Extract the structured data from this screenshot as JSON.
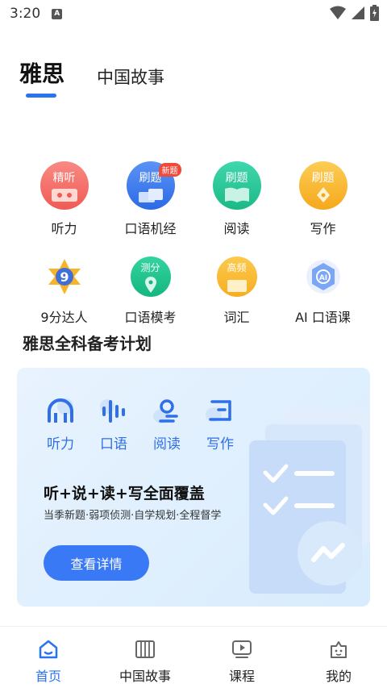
{
  "status": {
    "time": "3:20",
    "notification_letter": "A"
  },
  "top_tabs": [
    {
      "label": "雅思"
    },
    {
      "label": "中国故事"
    }
  ],
  "grid": [
    {
      "label": "听力",
      "icon_text": "精听",
      "icon": "listening-tape-icon",
      "color": "#f46b66"
    },
    {
      "label": "口语机经",
      "icon_text": "刷题",
      "icon": "speaking-mic-icon",
      "color": "#3c7bf0",
      "badge": "新题"
    },
    {
      "label": "阅读",
      "icon_text": "刷题",
      "icon": "reading-book-icon",
      "color": "#26c79a"
    },
    {
      "label": "写作",
      "icon_text": "刷题",
      "icon": "writing-pen-icon",
      "color": "#f7b62b"
    },
    {
      "label": "9分达人",
      "icon_text": "9",
      "icon": "star-nine-icon",
      "color": "#f7a71e"
    },
    {
      "label": "口语模考",
      "icon_text": "测分",
      "icon": "location-pin-icon",
      "color": "#1fc28c"
    },
    {
      "label": "词汇",
      "icon_text": "高频",
      "icon": "vocabulary-box-icon",
      "color": "#f9b937"
    },
    {
      "label": "AI  口语课",
      "icon_text": "AI",
      "icon": "ai-hexagon-icon",
      "color": "#5a8ff0"
    }
  ],
  "section_title": "雅思全科备考计划",
  "plan_card": {
    "skills": [
      {
        "label": "听力",
        "icon": "headphones-icon"
      },
      {
        "label": "口语",
        "icon": "soundwave-icon"
      },
      {
        "label": "阅读",
        "icon": "magnifier-icon"
      },
      {
        "label": "写作",
        "icon": "lines-icon"
      }
    ],
    "headline": "听+说+读+写全面覆盖",
    "subtitle": "当季新题·弱项侦测·自学规划·全程督学",
    "button_label": "查看详情"
  },
  "bottom_nav": [
    {
      "label": "首页",
      "icon": "home-icon"
    },
    {
      "label": "中国故事",
      "icon": "book-stack-icon"
    },
    {
      "label": "课程",
      "icon": "play-video-icon"
    },
    {
      "label": "我的",
      "icon": "profile-icon"
    }
  ],
  "colors": {
    "accent": "#2a73f0",
    "button": "#3a79f5"
  }
}
